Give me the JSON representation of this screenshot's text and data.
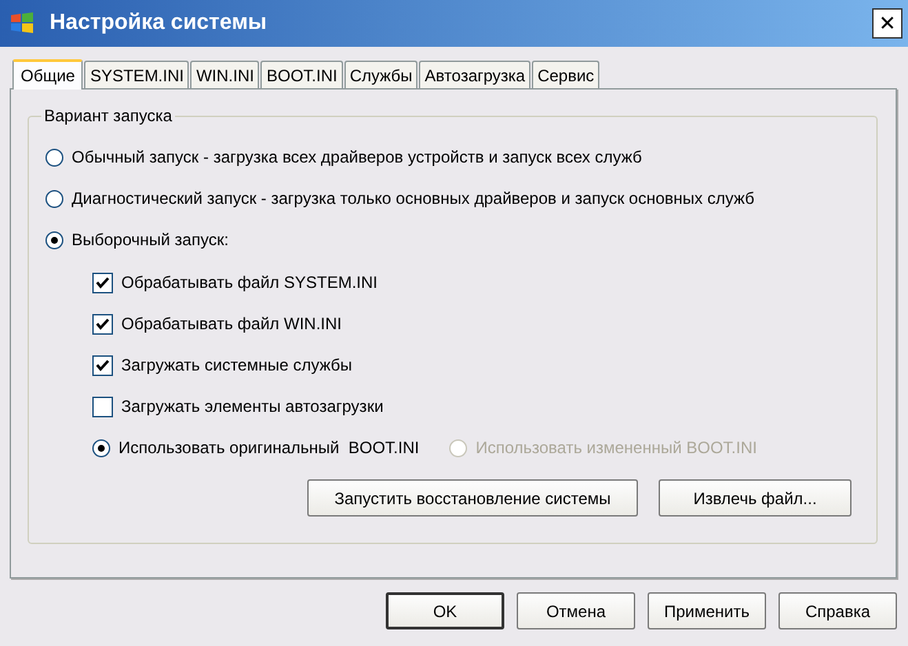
{
  "window": {
    "title": "Настройка системы",
    "close": "✕"
  },
  "tabs": [
    {
      "label": "Общие",
      "selected": true
    },
    {
      "label": "SYSTEM.INI",
      "selected": false
    },
    {
      "label": "WIN.INI",
      "selected": false
    },
    {
      "label": "BOOT.INI",
      "selected": false
    },
    {
      "label": "Службы",
      "selected": false
    },
    {
      "label": "Автозагрузка",
      "selected": false
    },
    {
      "label": "Сервис",
      "selected": false
    }
  ],
  "startup": {
    "legend": "Вариант запуска",
    "modes": [
      {
        "label": "Обычный запуск - загрузка всех драйверов устройств и запуск всех служб",
        "selected": false
      },
      {
        "label": "Диагностический запуск - загрузка только основных драйверов и запуск основных служб",
        "selected": false
      },
      {
        "label": "Выборочный запуск:",
        "selected": true
      }
    ],
    "selective": [
      {
        "label": "Обрабатывать файл SYSTEM.INI",
        "checked": true
      },
      {
        "label": "Обрабатывать файл WIN.INI",
        "checked": true
      },
      {
        "label": "Загружать системные службы",
        "checked": true
      },
      {
        "label": "Загружать элементы автозагрузки",
        "checked": false
      }
    ],
    "boot": [
      {
        "label": "Использовать оригинальный  BOOT.INI",
        "selected": true,
        "disabled": false
      },
      {
        "label": "Использовать измененный BOOT.INI",
        "selected": false,
        "disabled": true
      }
    ],
    "actions": [
      "Запустить восстановление системы",
      "Извлечь файл..."
    ]
  },
  "buttons": [
    {
      "label": "OK",
      "default": true
    },
    {
      "label": "Отмена",
      "default": false
    },
    {
      "label": "Применить",
      "default": false
    },
    {
      "label": "Справка",
      "default": false
    }
  ]
}
